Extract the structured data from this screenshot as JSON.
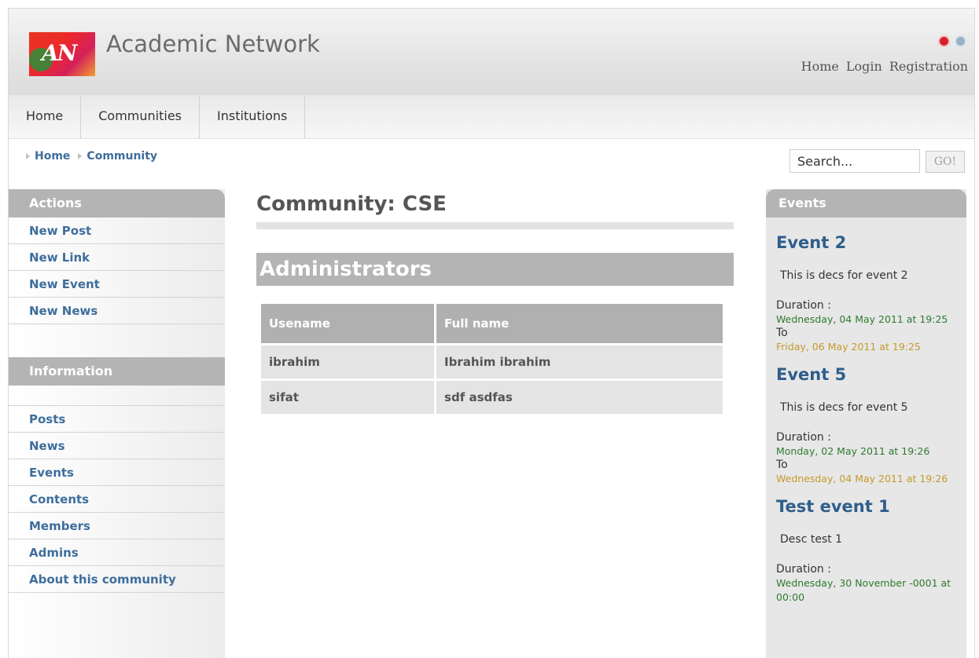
{
  "header": {
    "logo_text": "AN",
    "site_title": "Academic Network",
    "icons": [
      "clock-icon",
      "globe-icon"
    ],
    "links": [
      "Home",
      "Login",
      "Registration"
    ]
  },
  "nav": {
    "tabs": [
      "Home",
      "Communities",
      "Institutions"
    ]
  },
  "breadcrumb": {
    "items": [
      "Home",
      "Community"
    ]
  },
  "search": {
    "placeholder": "Search...",
    "button_label": "GO!"
  },
  "sidebar": {
    "actions_title": "Actions",
    "actions": [
      "New Post",
      "New Link",
      "New Event",
      "New News"
    ],
    "info_title": "Information",
    "info": [
      "Posts",
      "News",
      "Events",
      "Contents",
      "Members",
      "Admins",
      "About this community"
    ]
  },
  "main": {
    "title": "Community: CSE",
    "section": "Administrators",
    "table": {
      "headers": [
        "Usename",
        "Full name"
      ],
      "rows": [
        [
          "ibrahim",
          "Ibrahim ibrahim"
        ],
        [
          "sifat",
          "sdf asdfas"
        ]
      ]
    }
  },
  "events": {
    "title": "Events",
    "duration_label": "Duration :",
    "to_label": "To",
    "items": [
      {
        "title": "Event 2",
        "desc": "This is decs for event 2",
        "from": "Wednesday, 04 May 2011 at 19:25",
        "to": "Friday, 06 May 2011 at 19:25"
      },
      {
        "title": "Event 5",
        "desc": "This is decs for event 5",
        "from": "Monday, 02 May 2011 at 19:26",
        "to": "Wednesday, 04 May 2011 at 19:26"
      },
      {
        "title": "Test event 1",
        "desc": "Desc test 1",
        "from": "Wednesday, 30 November -0001 at 00:00",
        "to": ""
      }
    ]
  },
  "colors": {
    "link_blue": "#3e6e9c",
    "box_gray": "#b4b4b4",
    "from_green": "#2e7a2e",
    "to_gold": "#c49a2a"
  }
}
